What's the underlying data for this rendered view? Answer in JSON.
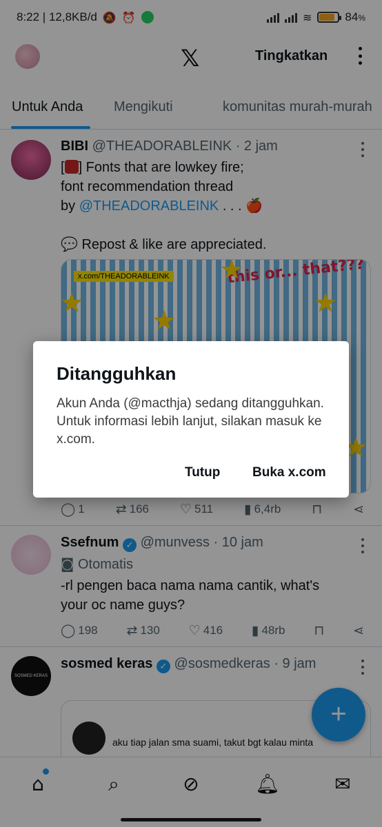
{
  "status_bar": {
    "time_speed": "8:22 | 12,8KB/d",
    "battery_pct": "84",
    "battery_unit": "%"
  },
  "header": {
    "logo": "𝕏",
    "upgrade_label": "Tingkatkan"
  },
  "tabs": [
    {
      "label": "Untuk Anda",
      "active": true
    },
    {
      "label": "Mengikuti",
      "active": false
    },
    {
      "label": "komunitas murah-murah",
      "active": false
    }
  ],
  "tweets": [
    {
      "name": "BIBI",
      "handle_time": "@THEADORABLEINK · 2 jam",
      "line1": "] Fonts that are lowkey fire;",
      "line1_prefix": "[",
      "line2": "font recommendation thread",
      "line3_prefix": "by ",
      "line3_link": "@THEADORABLEINK",
      "line3_suffix": " . . . 🍎",
      "line4": "💬 Repost & like are appreciated.",
      "media_tag": "x.com/THEADORABLEINK",
      "media_sticker": "this or... that???",
      "replies": "1",
      "reposts": "166",
      "likes": "511",
      "views": "6,4rb"
    },
    {
      "name": "Ssefnum",
      "handle_time": "@munvess · 10 jam",
      "automated": "Otomatis",
      "line1": "-rl pengen baca nama nama cantik, what's",
      "line2": "your oc name guys?",
      "replies": "198",
      "reposts": "130",
      "likes": "416",
      "views": "48rb"
    },
    {
      "name": "sosmed keras",
      "handle_time": "@sosmedkeras · 9 jam",
      "avatar_text": "SOSMED KERAS",
      "quote_text": "aku tiap jalan sma suami, takut bgt kalau minta"
    }
  ],
  "fab": {
    "icon": "+"
  },
  "dialog": {
    "title": "Ditangguhkan",
    "body": "Akun Anda (@macthja) sedang ditangguhkan. Untuk informasi lebih lanjut, silakan masuk ke x.com.",
    "close_label": "Tutup",
    "open_label": "Buka x.com"
  },
  "icons": {
    "reply": "💬",
    "repost": "⟲",
    "like": "♡",
    "views": "📊",
    "bookmark": "🔖",
    "share": "share-icon",
    "home": "home-icon",
    "search": "search-icon",
    "grok": "grok-icon",
    "notifications": "bell-icon",
    "messages": "mail-icon"
  },
  "colors": {
    "accent": "#1d9bf0",
    "scrim": "rgba(0,0,0,0.42)"
  }
}
